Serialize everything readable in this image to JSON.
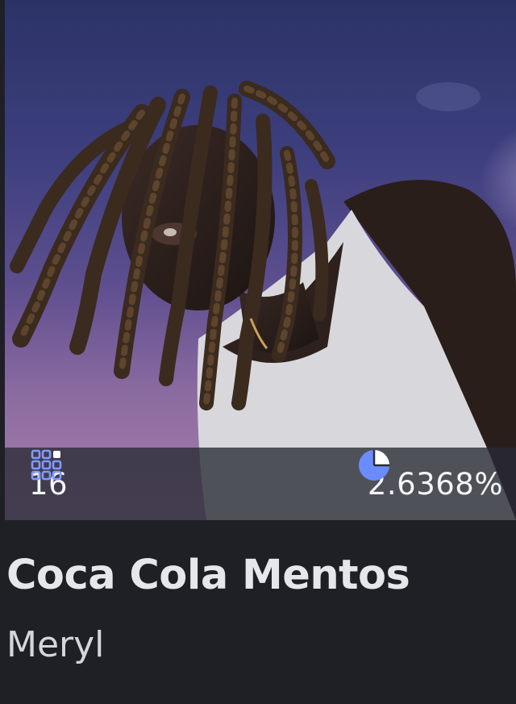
{
  "card": {
    "title": "Coca Cola Mentos",
    "artist": "Meryl",
    "artwork_icon": "portrait-artwork",
    "stats": {
      "editions": "16",
      "editions_icon": "grid-icon",
      "share": "2.6368%",
      "share_icon": "pie-chart-icon",
      "share_fraction": 0.026368
    }
  },
  "colors": {
    "background": "#1f2026",
    "accent": "#6b8cff",
    "text": "#e5e7eb"
  }
}
